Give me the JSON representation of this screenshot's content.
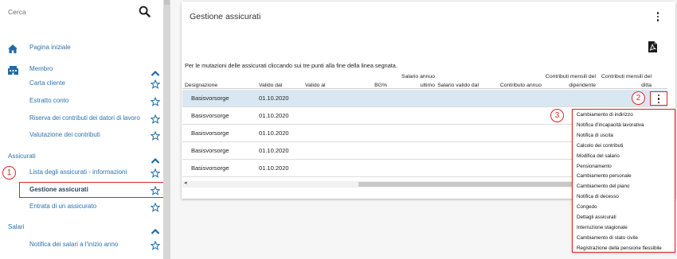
{
  "sidebar": {
    "search_placeholder": "Cerca",
    "home": "Pagina iniziale",
    "membro": {
      "label": "Membro",
      "items": [
        "Carta cliente",
        "Estratto conto",
        "Riserva dei contributi dei datori di lavoro",
        "Valutazione dei contributi"
      ]
    },
    "assicurati": {
      "label": "Assicurati",
      "items": [
        "Lista degli assicurati - informazioni",
        "Gestione assicurati",
        "Entrata di un assicurato"
      ]
    },
    "salari": {
      "label": "Salari",
      "items": [
        "Notifica dei salari a l'inizio anno"
      ]
    }
  },
  "annotations": [
    "1",
    "2",
    "3"
  ],
  "main": {
    "title": "Gestione assicurati",
    "instruction": "Per le mutazioni delle assicurati cliccando sui tre punti alla fine della linea segnata.",
    "columns": [
      "Designazione",
      "Valido dal",
      "Valido al",
      "BG%",
      "Salario annuo\nultimo",
      "Salario valido dal",
      "Contributo annuo",
      "Contributi mensili del\ndipendente",
      "Contributi mensili del\nditta"
    ],
    "rows": [
      {
        "designazione": "Basisvorsorge",
        "valido_dal": "01.10.2020"
      },
      {
        "designazione": "Basisvorsorge",
        "valido_dal": "01.10.2020"
      },
      {
        "designazione": "Basisvorsorge",
        "valido_dal": "01.10.2020"
      },
      {
        "designazione": "Basisvorsorge",
        "valido_dal": "01.10.2020"
      },
      {
        "designazione": "Basisvorsorge",
        "valido_dal": "01.10.2020"
      }
    ],
    "selected_row": 0
  },
  "context_menu": [
    "Cambiamento di indirizzo",
    "Notifica d'incapacità lavorativa",
    "Notifica di uscita",
    "Calcolo dei contributi",
    "Modifica del salario",
    "Pensionamento",
    "Cambiamento personale",
    "Cambiamento del piano",
    "Notifica di decesso",
    "Congedo",
    "Dettagli assicurati",
    "Interruzione stagionale",
    "Cambiamento di stato civile",
    "Registrazione della pensione flessibile"
  ],
  "icons": {
    "search": "search-icon",
    "home": "home-icon",
    "membro": "building-icon",
    "favorite": "star-outline-icon",
    "collapse": "chevron-up-icon",
    "more": "kebab-menu-icon",
    "pdf": "pdf-icon"
  },
  "colors": {
    "accent": "#2e72ae",
    "annotation": "#d9262b",
    "selected_row": "#d8e7f1"
  }
}
